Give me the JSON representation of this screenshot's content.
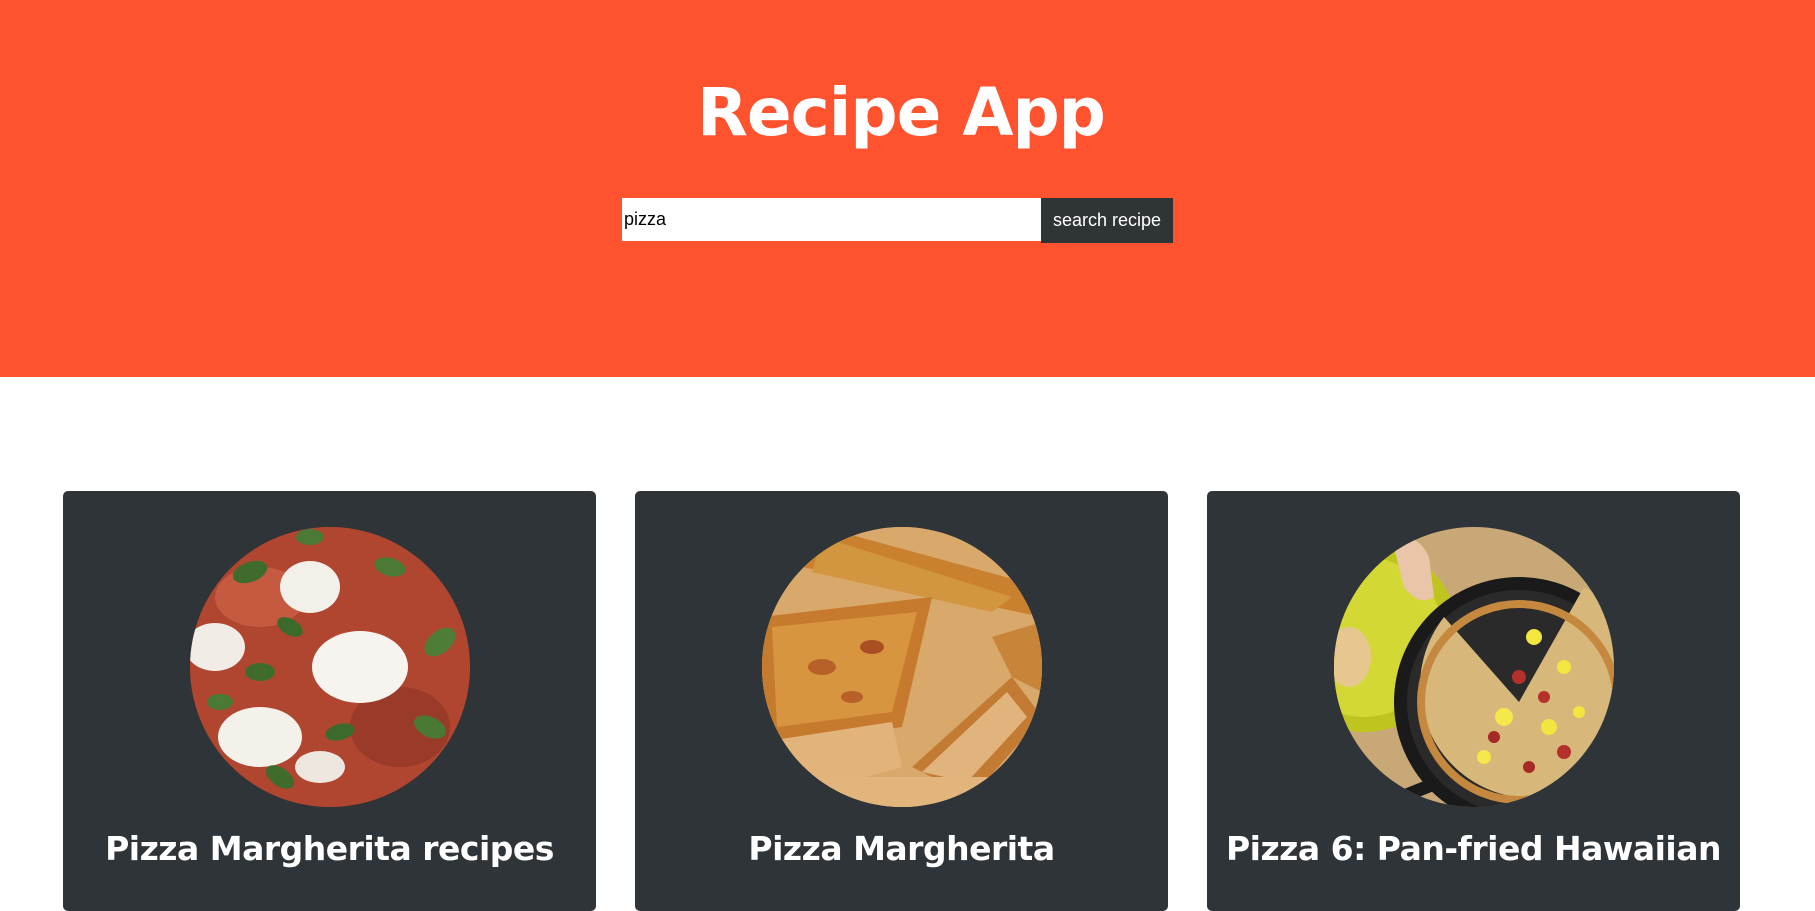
{
  "header": {
    "title": "Recipe App",
    "background_color": "#ff5330"
  },
  "search": {
    "value": "pizza",
    "button_label": "search recipe"
  },
  "recipes": [
    {
      "title": "Pizza Margherita recipes",
      "image": "pizza-margherita-photo"
    },
    {
      "title": "Pizza Margherita",
      "image": "pizza-slices-photo"
    },
    {
      "title": "Pizza 6: Pan-fried Hawaiian",
      "image": "pan-fried-hawaiian-pizza-photo"
    }
  ],
  "colors": {
    "accent": "#ff5330",
    "card_background": "#2e3437",
    "button_background": "#2f3437"
  }
}
